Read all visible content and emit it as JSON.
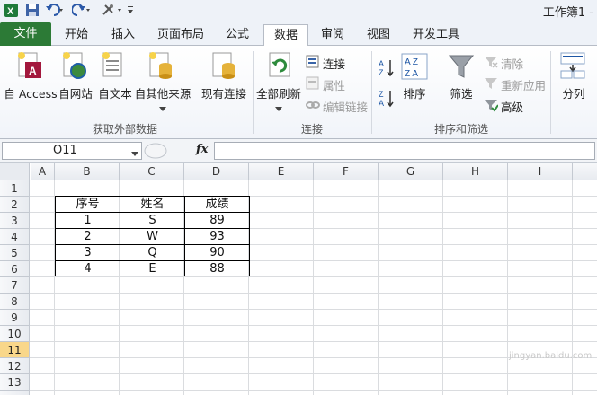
{
  "window": {
    "title": "工作簿1 -"
  },
  "tabs": [
    {
      "label": "文件"
    },
    {
      "label": "开始"
    },
    {
      "label": "插入"
    },
    {
      "label": "页面布局"
    },
    {
      "label": "公式"
    },
    {
      "label": "数据"
    },
    {
      "label": "审阅"
    },
    {
      "label": "视图"
    },
    {
      "label": "开发工具"
    }
  ],
  "ribbon": {
    "external": {
      "access": "自 Access",
      "web": "自网站",
      "text": "自文本",
      "other": "自其他来源",
      "existing": "现有连接",
      "group": "获取外部数据"
    },
    "connections": {
      "refresh_all": "全部刷新",
      "connections": "连接",
      "properties": "属性",
      "edit_links": "编辑链接",
      "group": "连接"
    },
    "sort_filter": {
      "sort": "排序",
      "filter": "筛选",
      "clear": "清除",
      "reapply": "重新应用",
      "advanced": "高级",
      "group": "排序和筛选"
    },
    "tools": {
      "split": "分列"
    }
  },
  "formula_bar": {
    "name_box": "O11",
    "fx": "fx",
    "value": ""
  },
  "sheet": {
    "columns": [
      "A",
      "B",
      "C",
      "D",
      "E",
      "F",
      "G",
      "H",
      "I"
    ],
    "rows": [
      "1",
      "2",
      "3",
      "4",
      "5",
      "6",
      "7",
      "8",
      "9",
      "10",
      "11",
      "12",
      "13"
    ],
    "selected_row": "11",
    "table": {
      "headers": [
        "序号",
        "姓名",
        "成绩"
      ],
      "rows": [
        [
          "1",
          "S",
          "89"
        ],
        [
          "2",
          "W",
          "93"
        ],
        [
          "3",
          "Q",
          "90"
        ],
        [
          "4",
          "E",
          "88"
        ]
      ]
    }
  },
  "watermark": "jingyan.baidu.com",
  "colors": {
    "file_tab": "#2c7a36",
    "selected_row": "#f9d78a"
  }
}
